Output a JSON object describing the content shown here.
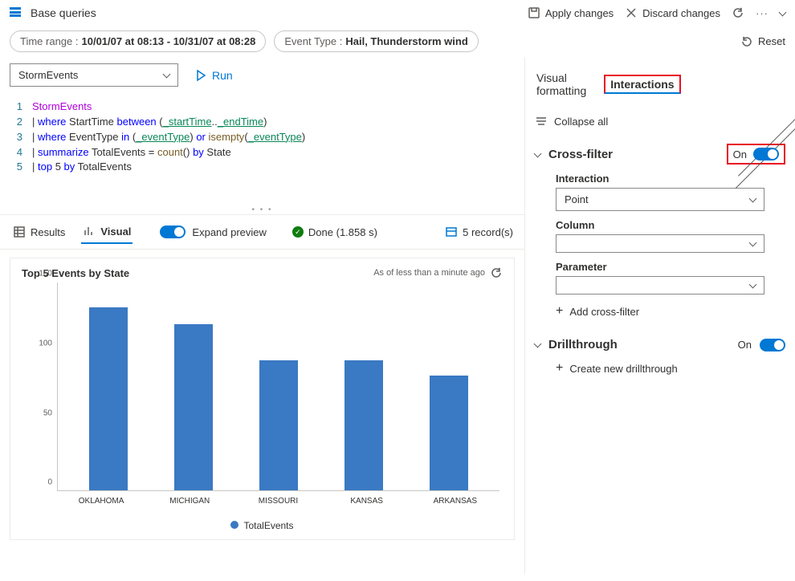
{
  "header": {
    "title": "Base queries",
    "apply": "Apply changes",
    "discard": "Discard changes"
  },
  "filters": {
    "time_label": "Time range :",
    "time_value": "10/01/07 at 08:13 - 10/31/07 at 08:28",
    "type_label": "Event Type :",
    "type_value": "Hail, Thunderstorm wind",
    "reset": "Reset"
  },
  "query": {
    "source": "StormEvents",
    "run": "Run",
    "lines": {
      "l1": "StormEvents",
      "l2a": "| ",
      "l2b": "where",
      "l2c": " StartTime ",
      "l2d": "between",
      "l2e": " (",
      "l2f": "_startTime",
      "l2g": "..",
      "l2h": "_endTime",
      "l2i": ")",
      "l3a": "| ",
      "l3b": "where",
      "l3c": " EventType ",
      "l3d": "in",
      "l3e": " (",
      "l3f": "_eventType",
      "l3g": ") ",
      "l3h": "or",
      "l3i": " ",
      "l3j": "isempty",
      "l3k": "(",
      "l3l": "_eventType",
      "l3m": ")",
      "l4a": "| ",
      "l4b": "summarize",
      "l4c": " TotalEvents = ",
      "l4d": "count",
      "l4e": "() ",
      "l4f": "by",
      "l4g": " State",
      "l5a": "| ",
      "l5b": "top",
      "l5c": " 5 ",
      "l5d": "by",
      "l5e": " TotalEvents"
    }
  },
  "tabs": {
    "results": "Results",
    "visual": "Visual",
    "expand": "Expand preview",
    "done": "Done (1.858 s)",
    "records": "5 record(s)"
  },
  "chart_data": {
    "type": "bar",
    "title": "Top 5 Events by State",
    "meta": "As of less than a minute ago",
    "legend": "TotalEvents",
    "ylim": [
      0,
      150
    ],
    "yticks": [
      "0",
      "50",
      "100",
      "150"
    ],
    "categories": [
      "OKLAHOMA",
      "MICHIGAN",
      "MISSOURI",
      "KANSAS",
      "ARKANSAS"
    ],
    "values": [
      132,
      120,
      94,
      94,
      83
    ]
  },
  "panel": {
    "tab_visual": "Visual formatting",
    "tab_inter": "Interactions",
    "collapse": "Collapse all",
    "crossfilter": {
      "title": "Cross-filter",
      "on": "On",
      "interaction_lbl": "Interaction",
      "interaction_val": "Point",
      "column_lbl": "Column",
      "parameter_lbl": "Parameter",
      "add": "Add cross-filter"
    },
    "drill": {
      "title": "Drillthrough",
      "on": "On",
      "create": "Create new drillthrough"
    }
  }
}
